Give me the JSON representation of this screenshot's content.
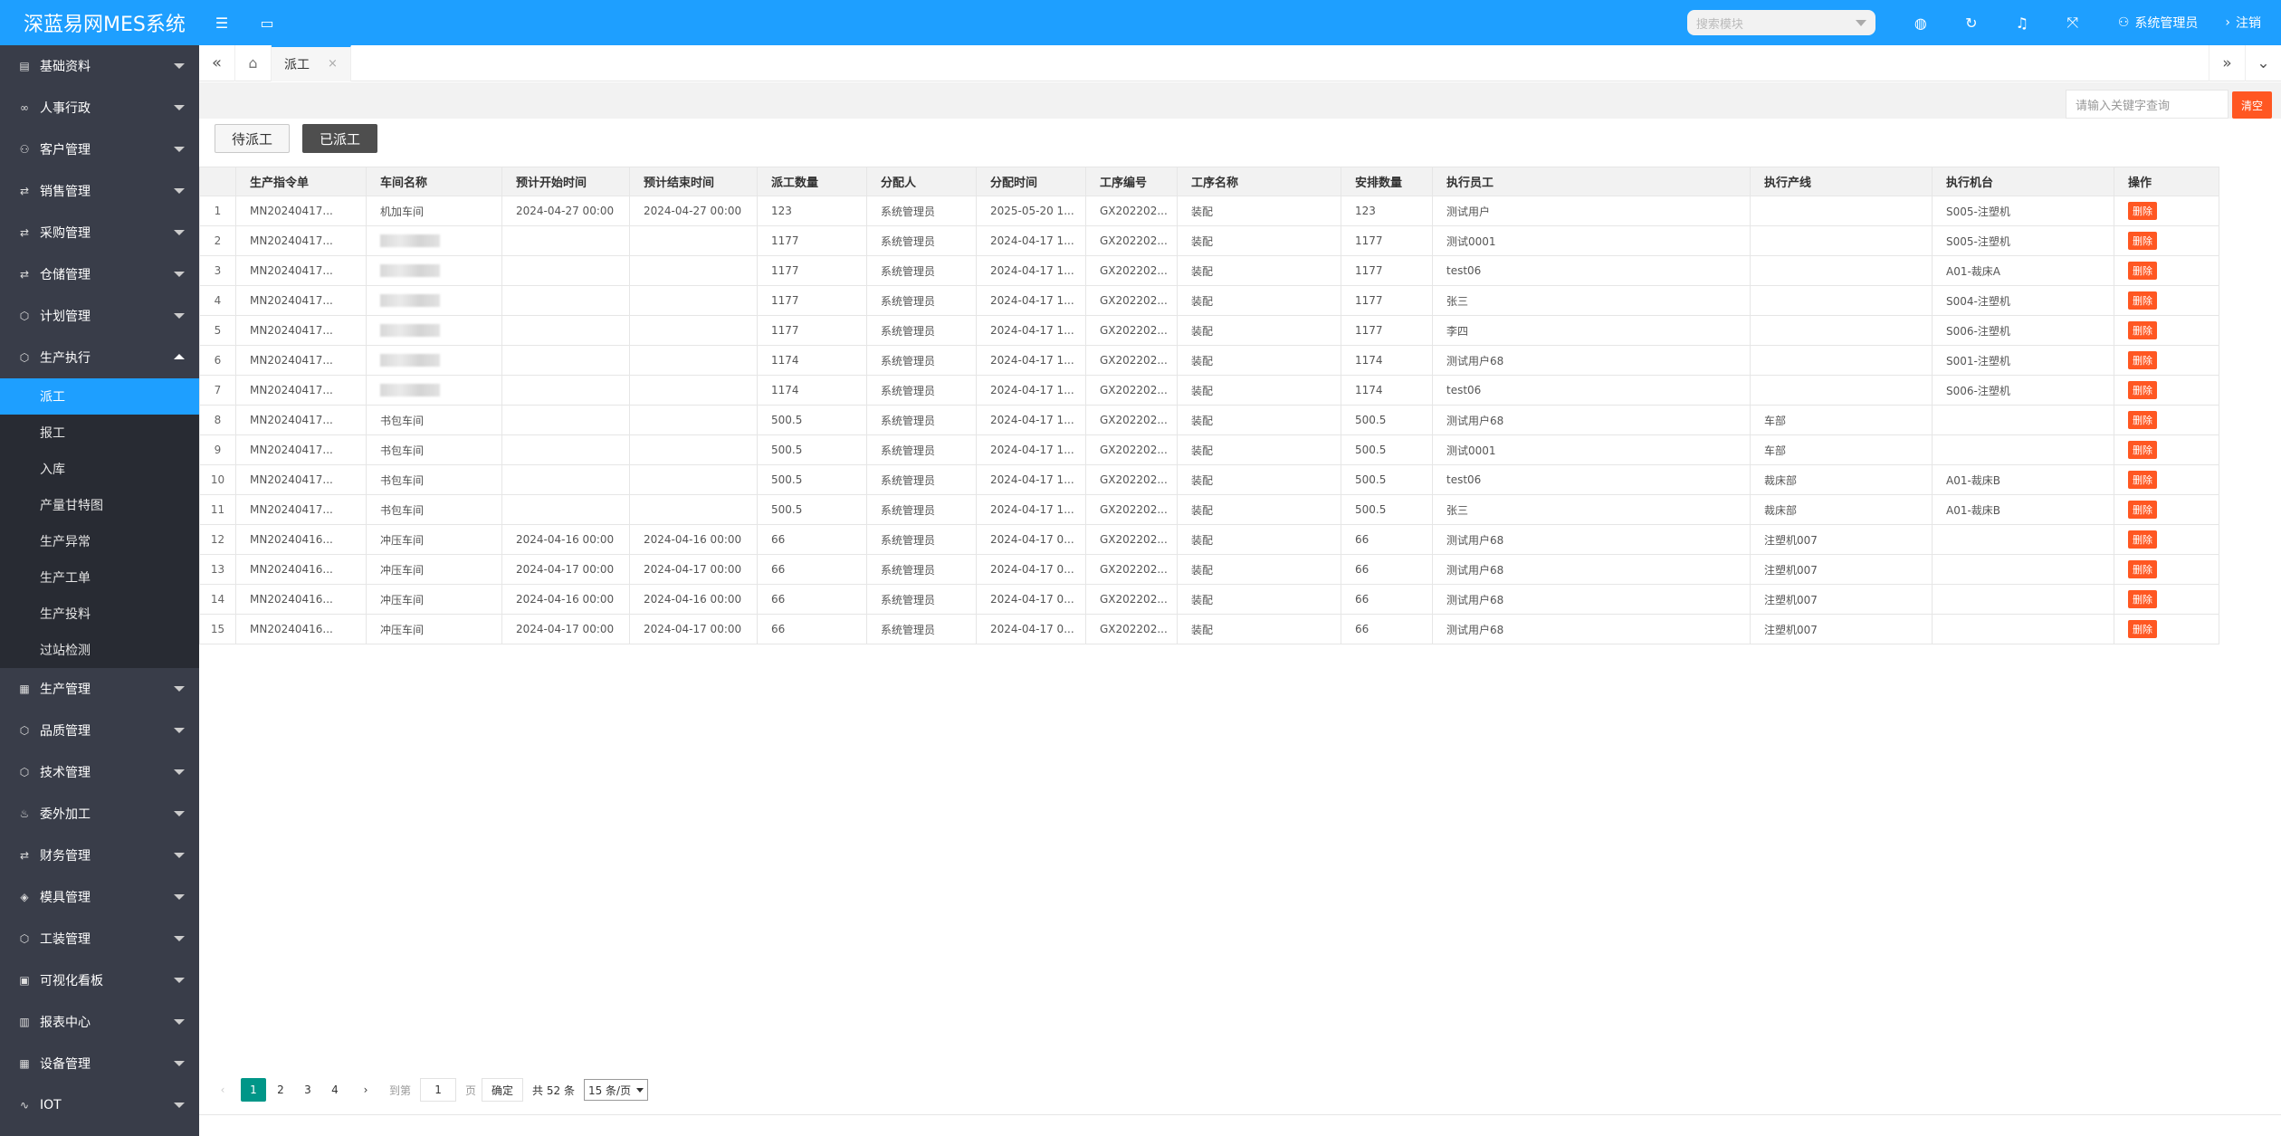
{
  "app": {
    "title": "深蓝易网MES系统"
  },
  "topbar": {
    "search_placeholder": "搜索模块",
    "user": "系统管理员",
    "logout": "注销"
  },
  "sidebar": {
    "top_items": [
      {
        "label": "基础资料",
        "icon": "book-icon"
      },
      {
        "label": "人事行政",
        "icon": "link-icon"
      },
      {
        "label": "客户管理",
        "icon": "user-icon"
      },
      {
        "label": "销售管理",
        "icon": "shuffle-icon"
      },
      {
        "label": "采购管理",
        "icon": "shuffle-icon"
      },
      {
        "label": "仓储管理",
        "icon": "shuffle-icon"
      },
      {
        "label": "计划管理",
        "icon": "cube-icon"
      }
    ],
    "open_group": {
      "label": "生产执行",
      "icon": "cube-icon"
    },
    "sub_items": [
      "派工",
      "报工",
      "入库",
      "产量甘特图",
      "生产异常",
      "生产工单",
      "生产投料",
      "过站检测"
    ],
    "active_sub": "派工",
    "bottom_items": [
      {
        "label": "生产管理",
        "icon": "chart-icon"
      },
      {
        "label": "品质管理",
        "icon": "cube-icon"
      },
      {
        "label": "技术管理",
        "icon": "cube-icon"
      },
      {
        "label": "委外加工",
        "icon": "drop-icon"
      },
      {
        "label": "财务管理",
        "icon": "shuffle-icon"
      },
      {
        "label": "模具管理",
        "icon": "layers-icon"
      },
      {
        "label": "工装管理",
        "icon": "cube-icon"
      },
      {
        "label": "可视化看板",
        "icon": "chat-icon"
      },
      {
        "label": "报表中心",
        "icon": "table-icon"
      },
      {
        "label": "设备管理",
        "icon": "chart-icon"
      },
      {
        "label": "IOT",
        "icon": "pulse-icon"
      }
    ]
  },
  "tabs": {
    "active_tab": "派工",
    "close": "×"
  },
  "search": {
    "keyword_placeholder": "请输入关键字查询",
    "clear_label": "清空"
  },
  "status_tabs": {
    "pending": "待派工",
    "dispatched": "已派工"
  },
  "table": {
    "headers": [
      "",
      "生产指令单",
      "车间名称",
      "预计开始时间",
      "预计结束时间",
      "派工数量",
      "分配人",
      "分配时间",
      "工序编号",
      "工序名称",
      "安排数量",
      "执行员工",
      "执行产线",
      "执行机台",
      "操作"
    ],
    "action_label": "删除",
    "rows": [
      [
        "1",
        "MN20240417...",
        "机加车间",
        "2024-04-27 00:00",
        "2024-04-27 00:00",
        "123",
        "系统管理员",
        "2025-05-20 1...",
        "GX202202...",
        "装配",
        "123",
        "测试用户",
        "",
        "S005-注塑机"
      ],
      [
        "2",
        "MN20240417...",
        "",
        "",
        "",
        "1177",
        "系统管理员",
        "2024-04-17 1...",
        "GX202202...",
        "装配",
        "1177",
        "测试0001",
        "",
        "S005-注塑机"
      ],
      [
        "3",
        "MN20240417...",
        "",
        "",
        "",
        "1177",
        "系统管理员",
        "2024-04-17 1...",
        "GX202202...",
        "装配",
        "1177",
        "test06",
        "",
        "A01-裁床A"
      ],
      [
        "4",
        "MN20240417...",
        "",
        "",
        "",
        "1177",
        "系统管理员",
        "2024-04-17 1...",
        "GX202202...",
        "装配",
        "1177",
        "张三",
        "",
        "S004-注塑机"
      ],
      [
        "5",
        "MN20240417...",
        "",
        "",
        "",
        "1177",
        "系统管理员",
        "2024-04-17 1...",
        "GX202202...",
        "装配",
        "1177",
        "李四",
        "",
        "S006-注塑机"
      ],
      [
        "6",
        "MN20240417...",
        "",
        "",
        "",
        "1174",
        "系统管理员",
        "2024-04-17 1...",
        "GX202202...",
        "装配",
        "1174",
        "测试用户68",
        "",
        "S001-注塑机"
      ],
      [
        "7",
        "MN20240417...",
        "",
        "",
        "",
        "1174",
        "系统管理员",
        "2024-04-17 1...",
        "GX202202...",
        "装配",
        "1174",
        "test06",
        "",
        "S006-注塑机"
      ],
      [
        "8",
        "MN20240417...",
        "书包车间",
        "",
        "",
        "500.5",
        "系统管理员",
        "2024-04-17 1...",
        "GX202202...",
        "装配",
        "500.5",
        "测试用户68",
        "车部",
        ""
      ],
      [
        "9",
        "MN20240417...",
        "书包车间",
        "",
        "",
        "500.5",
        "系统管理员",
        "2024-04-17 1...",
        "GX202202...",
        "装配",
        "500.5",
        "测试0001",
        "车部",
        ""
      ],
      [
        "10",
        "MN20240417...",
        "书包车间",
        "",
        "",
        "500.5",
        "系统管理员",
        "2024-04-17 1...",
        "GX202202...",
        "装配",
        "500.5",
        "test06",
        "裁床部",
        "A01-裁床B"
      ],
      [
        "11",
        "MN20240417...",
        "书包车间",
        "",
        "",
        "500.5",
        "系统管理员",
        "2024-04-17 1...",
        "GX202202...",
        "装配",
        "500.5",
        "张三",
        "裁床部",
        "A01-裁床B"
      ],
      [
        "12",
        "MN20240416...",
        "冲压车间",
        "2024-04-16 00:00",
        "2024-04-16 00:00",
        "66",
        "系统管理员",
        "2024-04-17 0...",
        "GX202202...",
        "装配",
        "66",
        "测试用户68",
        "注塑机007",
        ""
      ],
      [
        "13",
        "MN20240416...",
        "冲压车间",
        "2024-04-17 00:00",
        "2024-04-17 00:00",
        "66",
        "系统管理员",
        "2024-04-17 0...",
        "GX202202...",
        "装配",
        "66",
        "测试用户68",
        "注塑机007",
        ""
      ],
      [
        "14",
        "MN20240416...",
        "冲压车间",
        "2024-04-16 00:00",
        "2024-04-16 00:00",
        "66",
        "系统管理员",
        "2024-04-17 0...",
        "GX202202...",
        "装配",
        "66",
        "测试用户68",
        "注塑机007",
        ""
      ],
      [
        "15",
        "MN20240416...",
        "冲压车间",
        "2024-04-17 00:00",
        "2024-04-17 00:00",
        "66",
        "系统管理员",
        "2024-04-17 0...",
        "GX202202...",
        "装配",
        "66",
        "测试用户68",
        "注塑机007",
        ""
      ]
    ],
    "blurred_rows": [
      2,
      3,
      4,
      5,
      6,
      7
    ]
  },
  "pager": {
    "pages": [
      "1",
      "2",
      "3",
      "4"
    ],
    "current": "1",
    "goto_prefix": "到第",
    "goto_value": "1",
    "goto_suffix": "页",
    "confirm": "确定",
    "total": "共 52 条",
    "page_size": "15 条/页"
  },
  "colors": {
    "primary": "#1e9fff",
    "sidebar": "#393d49",
    "danger": "#ff5722",
    "pager_active": "#009688"
  }
}
